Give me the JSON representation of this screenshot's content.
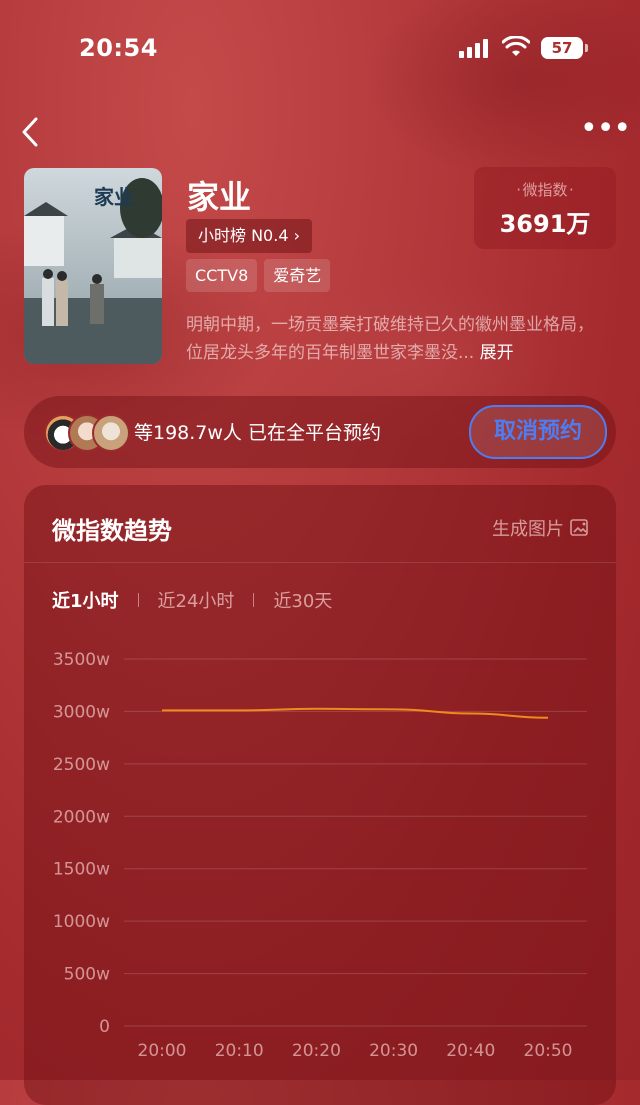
{
  "status_bar": {
    "time": "20:54",
    "battery": "57"
  },
  "show": {
    "title": "家业",
    "rank_label": "小时榜 N0.4",
    "tags": [
      "CCTV8",
      "爱奇艺"
    ],
    "description": "明朝中期，一场贡墨案打破维持已久的徽州墨业格局，位居龙头多年的百年制墨世家李墨没...",
    "expand_label": "展开",
    "poster_text": "家业"
  },
  "index": {
    "label": "微指数",
    "value": "3691万"
  },
  "reservation": {
    "text": "等198.7w人 已在全平台预约",
    "button_label": "取消预约"
  },
  "trend": {
    "title": "微指数趋势",
    "generate_label": "生成图片",
    "tabs": [
      "近1小时",
      "近24小时",
      "近30天"
    ],
    "active_tab": 0
  },
  "chart_data": {
    "type": "line",
    "x": [
      "20:00",
      "20:10",
      "20:20",
      "20:30",
      "20:40",
      "20:50"
    ],
    "series": [
      {
        "values": [
          3010,
          3010,
          3025,
          3020,
          2980,
          2940
        ],
        "color": "#f08a1c"
      }
    ],
    "y_ticks": [
      "0",
      "500w",
      "1000w",
      "1500w",
      "2000w",
      "2500w",
      "3000w",
      "3500w"
    ],
    "ylim": [
      0,
      3500
    ],
    "grid": true
  }
}
